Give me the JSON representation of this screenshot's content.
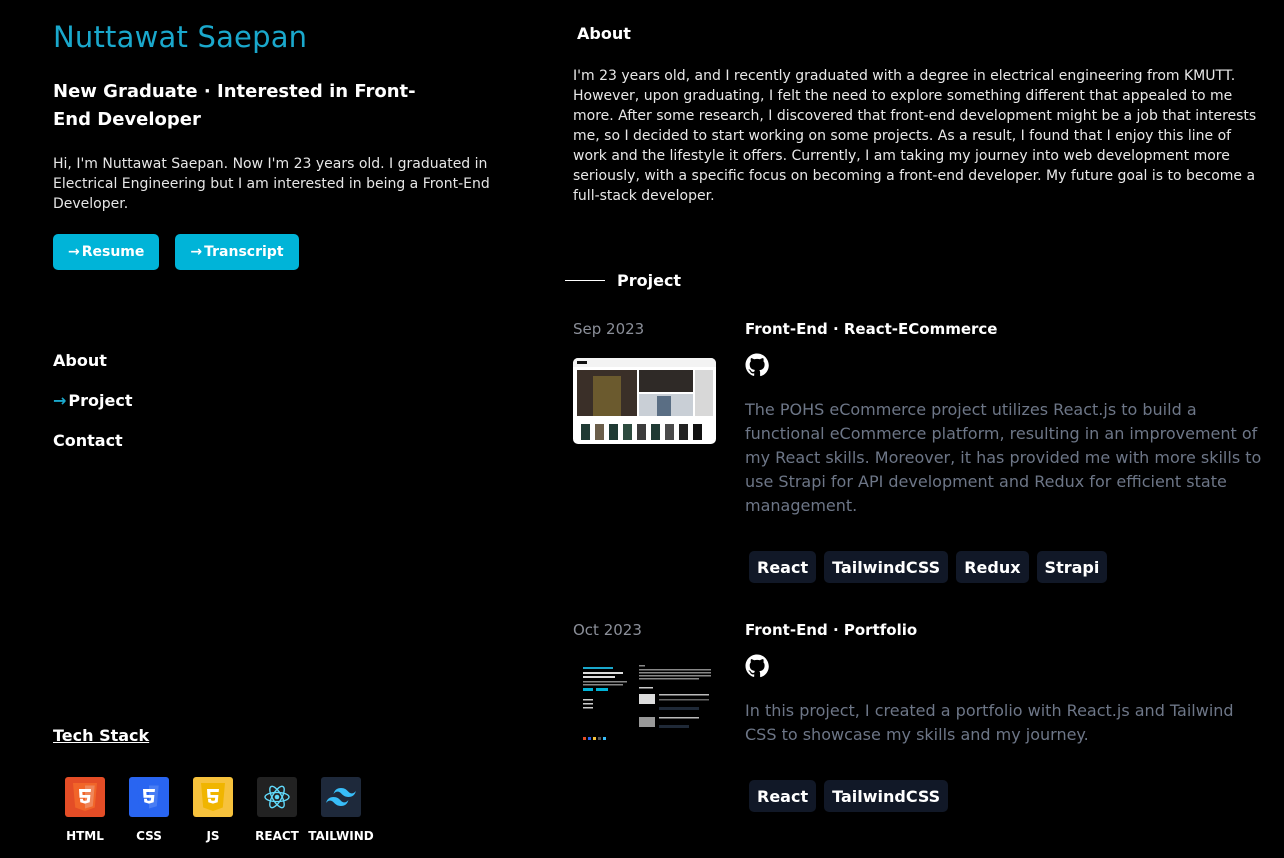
{
  "profile": {
    "name": "Nuttawat Saepan",
    "subtitle": "New Graduate · Interested in Front-End Developer",
    "intro": "Hi, I'm Nuttawat Saepan. Now I'm 23 years old. I graduated in Electrical Engineering but I am interested in being a Front-End Developer.",
    "buttons": {
      "resume": "Resume",
      "transcript": "Transcript",
      "arrow": "→"
    }
  },
  "nav": {
    "about": "About",
    "project": "Project",
    "contact": "Contact",
    "active_arrow": "→"
  },
  "tech_stack": {
    "title": "Tech Stack",
    "items": [
      {
        "label": "HTML",
        "icon": "html5-icon",
        "color": "#e44d26"
      },
      {
        "label": "CSS",
        "icon": "css3-icon",
        "color": "#2965f1"
      },
      {
        "label": "JS",
        "icon": "js-icon",
        "color": "#f7c23c"
      },
      {
        "label": "REACT",
        "icon": "react-icon",
        "color": "#222222"
      },
      {
        "label": "TAILWIND",
        "icon": "tailwind-icon",
        "color": "#1e293b"
      }
    ]
  },
  "about": {
    "heading": "About",
    "text": "I'm 23 years old, and I recently graduated with a degree in electrical engineering from KMUTT. However, upon graduating, I felt the need to explore something different that appealed to me more. After some research, I discovered that front-end development might be a job that interests me, so I decided to start working on some projects. As a result, I found that I enjoy this line of work and the lifestyle it offers. Currently, I am taking my journey into web development more seriously, with a specific focus on becoming a front-end developer. My future goal is to become a full-stack developer."
  },
  "projects": {
    "heading": "Project",
    "items": [
      {
        "date": "Sep 2023",
        "title": "Front-End · React-ECommerce",
        "description": "The POHS eCommerce project utilizes React.js to build a functional eCommerce platform, resulting in an improvement of my React skills. Moreover, it has provided me with more skills to use Strapi for API development and Redux for efficient state management.",
        "tags": [
          "React",
          "TailwindCSS",
          "Redux",
          "Strapi"
        ]
      },
      {
        "date": "Oct 2023",
        "title": "Front-End · Portfolio",
        "description": "In this project, I created a portfolio with React.js and Tailwind CSS to showcase my skills and my journey.",
        "tags": [
          "React",
          "TailwindCSS"
        ]
      }
    ]
  },
  "colors": {
    "accent": "#1aa8cc",
    "button": "#00b4d8",
    "muted": "#6d7687",
    "tag_bg": "#111827"
  }
}
